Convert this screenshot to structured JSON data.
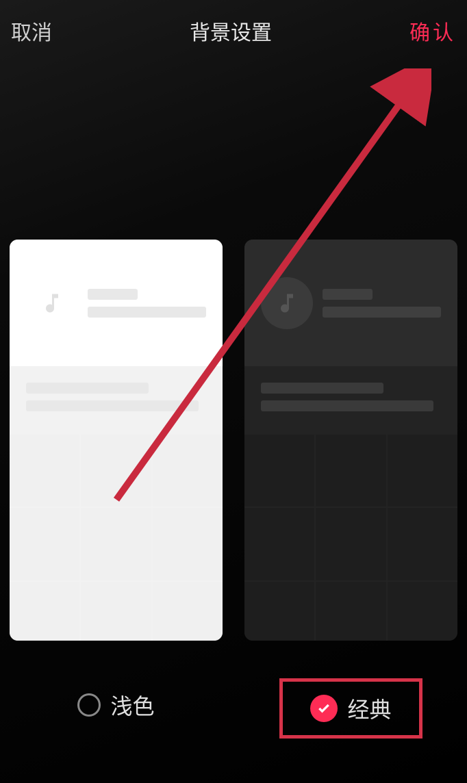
{
  "header": {
    "cancel": "取消",
    "title": "背景设置",
    "confirm": "确认"
  },
  "themes": {
    "light": {
      "label": "浅色",
      "selected": false
    },
    "dark": {
      "label": "经典",
      "selected": true
    }
  }
}
